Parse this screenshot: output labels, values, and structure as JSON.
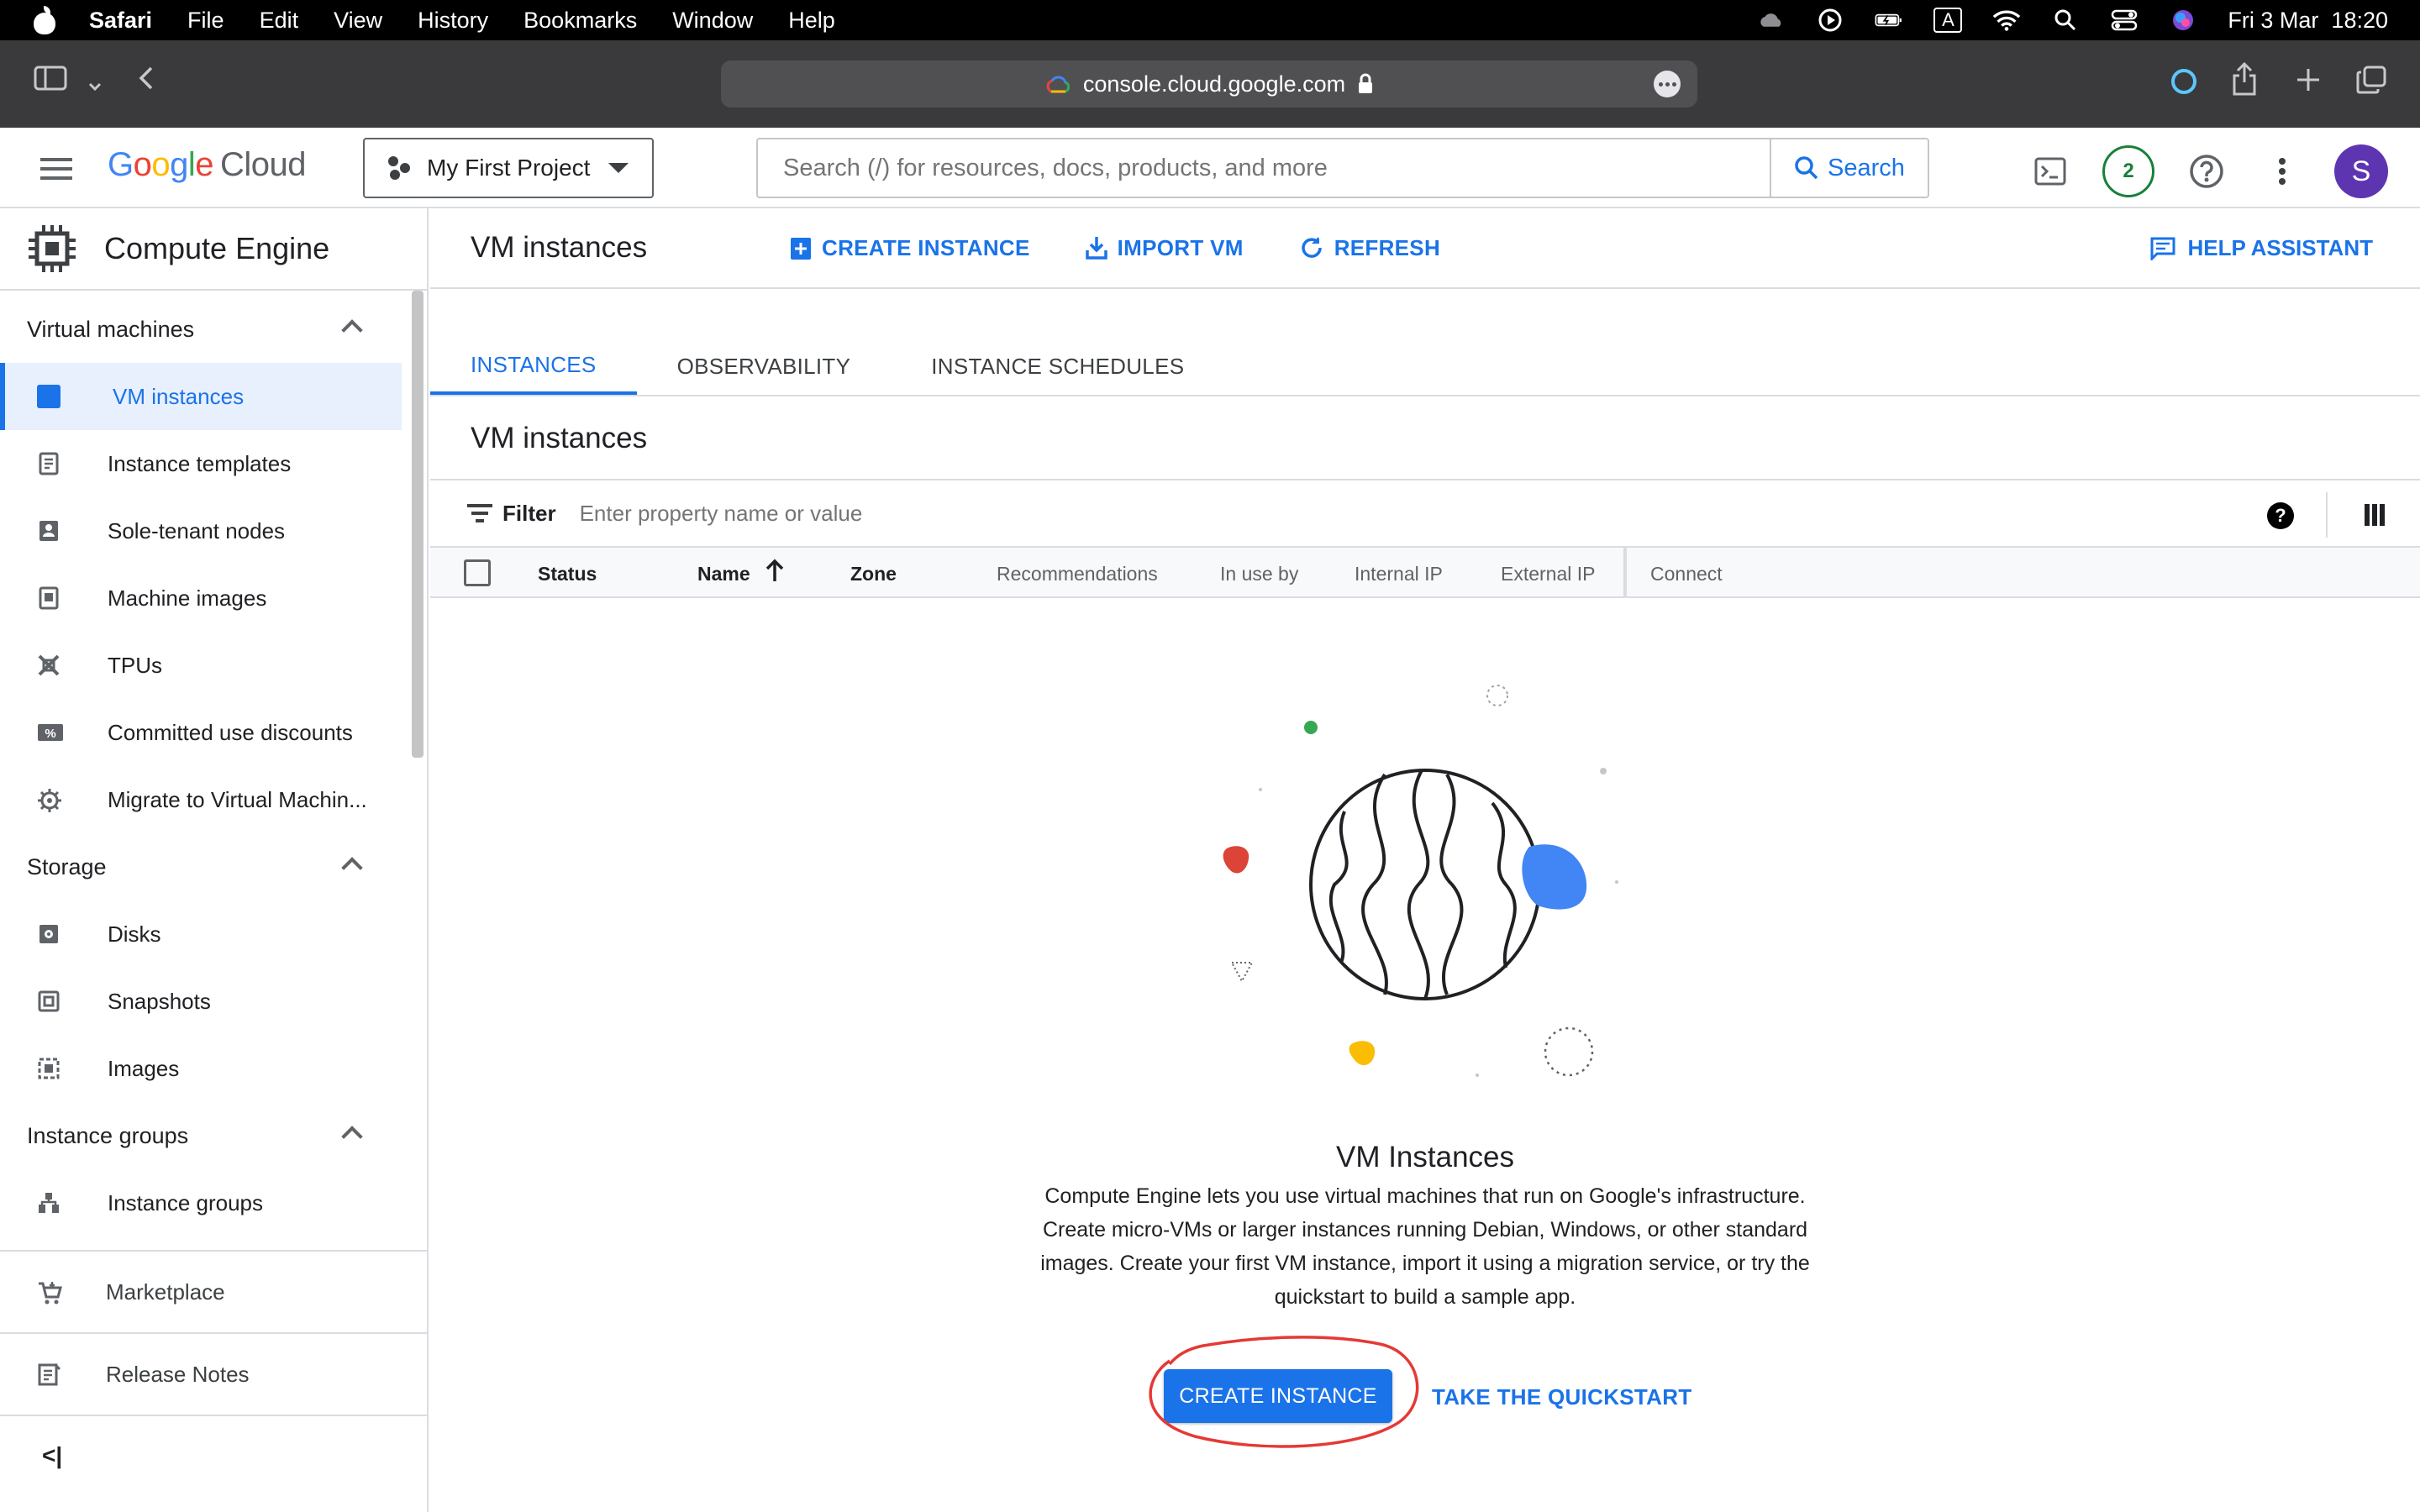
{
  "macos_menubar": {
    "app_name": "Safari",
    "menus": [
      "File",
      "Edit",
      "View",
      "History",
      "Bookmarks",
      "Window",
      "Help"
    ],
    "datetime": "Fri 3 Mar  18:20",
    "keyboard_indicator": "A"
  },
  "safari": {
    "url": "console.cloud.google.com"
  },
  "gcp_header": {
    "logo_google": [
      "G",
      "o",
      "o",
      "g",
      "l",
      "e"
    ],
    "logo_cloud": "Cloud",
    "project_name": "My First Project",
    "search_placeholder": "Search (/) for resources, docs, products, and more",
    "search_button": "Search",
    "notifications_count": "2",
    "avatar_initial": "S"
  },
  "sidebar": {
    "product_title": "Compute Engine",
    "sections": [
      {
        "label": "Virtual machines",
        "items": [
          "VM instances",
          "Instance templates",
          "Sole-tenant nodes",
          "Machine images",
          "TPUs",
          "Committed use discounts",
          "Migrate to Virtual Machin..."
        ]
      },
      {
        "label": "Storage",
        "items": [
          "Disks",
          "Snapshots",
          "Images"
        ]
      },
      {
        "label": "Instance groups",
        "items": [
          "Instance groups"
        ]
      }
    ],
    "active_item": "VM instances",
    "marketplace": "Marketplace",
    "release_notes": "Release Notes",
    "collapse_glyph": "<|"
  },
  "main": {
    "page_title": "VM instances",
    "actions": {
      "create_instance": "CREATE INSTANCE",
      "import_vm": "IMPORT VM",
      "refresh": "REFRESH",
      "help_assistant": "HELP ASSISTANT"
    },
    "tabs": [
      "INSTANCES",
      "OBSERVABILITY",
      "INSTANCE SCHEDULES"
    ],
    "active_tab": "INSTANCES",
    "section_title": "VM instances",
    "filter_label": "Filter",
    "filter_placeholder": "Enter property name or value",
    "table_headers": [
      "Status",
      "Name",
      "Zone",
      "Recommendations",
      "In use by",
      "Internal IP",
      "External IP",
      "Connect"
    ],
    "empty_state": {
      "title": "VM Instances",
      "description": "Compute Engine lets you use virtual machines that run on Google's infrastructure. Create micro-VMs or larger instances running Debian, Windows, or other standard images. Create your first VM instance, import it using a migration service, or try the quickstart to build a sample app.",
      "primary_button": "CREATE INSTANCE",
      "secondary_link": "TAKE THE QUICKSTART"
    }
  },
  "colors": {
    "accent_blue": "#1a73e8",
    "active_bg": "#e8f0fe",
    "annotation_red": "#e53935",
    "avatar_purple": "#5e35b1"
  }
}
